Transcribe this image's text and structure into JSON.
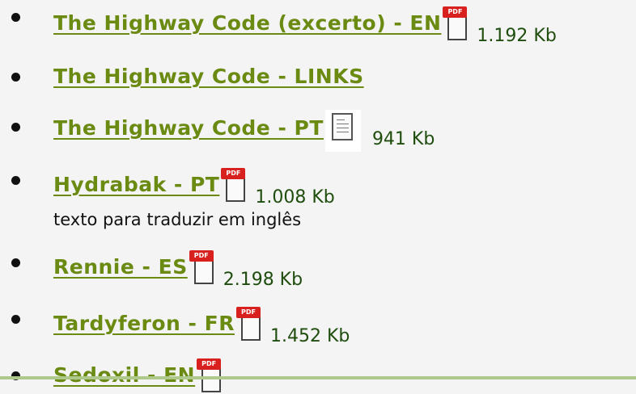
{
  "items": [
    {
      "link": "The Highway Code (excerto) - EN",
      "icon": "pdf-icon",
      "icon_badge": "PDF",
      "size": "1.192 Kb",
      "note": ""
    },
    {
      "link": "The Highway Code - LINKS",
      "icon": "",
      "icon_badge": "",
      "size": "",
      "note": ""
    },
    {
      "link": "The Highway Code - PT",
      "icon": "document-icon",
      "icon_badge": "",
      "size": "941 Kb",
      "note": ""
    },
    {
      "link": "Hydrabak - PT",
      "icon": "pdf-icon",
      "icon_badge": "PDF",
      "size": "1.008 Kb",
      "note": "texto para traduzir em inglês"
    },
    {
      "link": "Rennie - ES",
      "icon": "pdf-icon",
      "icon_badge": "PDF",
      "size": "2.198 Kb",
      "note": ""
    },
    {
      "link": "Tardyferon - FR",
      "icon": "pdf-icon",
      "icon_badge": "PDF",
      "size": "1.452 Kb",
      "note": ""
    },
    {
      "link": "Sedoxil - EN",
      "icon": "pdf-icon",
      "icon_badge": "PDF",
      "size": "",
      "note": ""
    }
  ],
  "colors": {
    "link": "#6a8a12",
    "size": "#1f4d0e",
    "pdf_badge": "#d8211e",
    "background": "#f4f4f4"
  }
}
